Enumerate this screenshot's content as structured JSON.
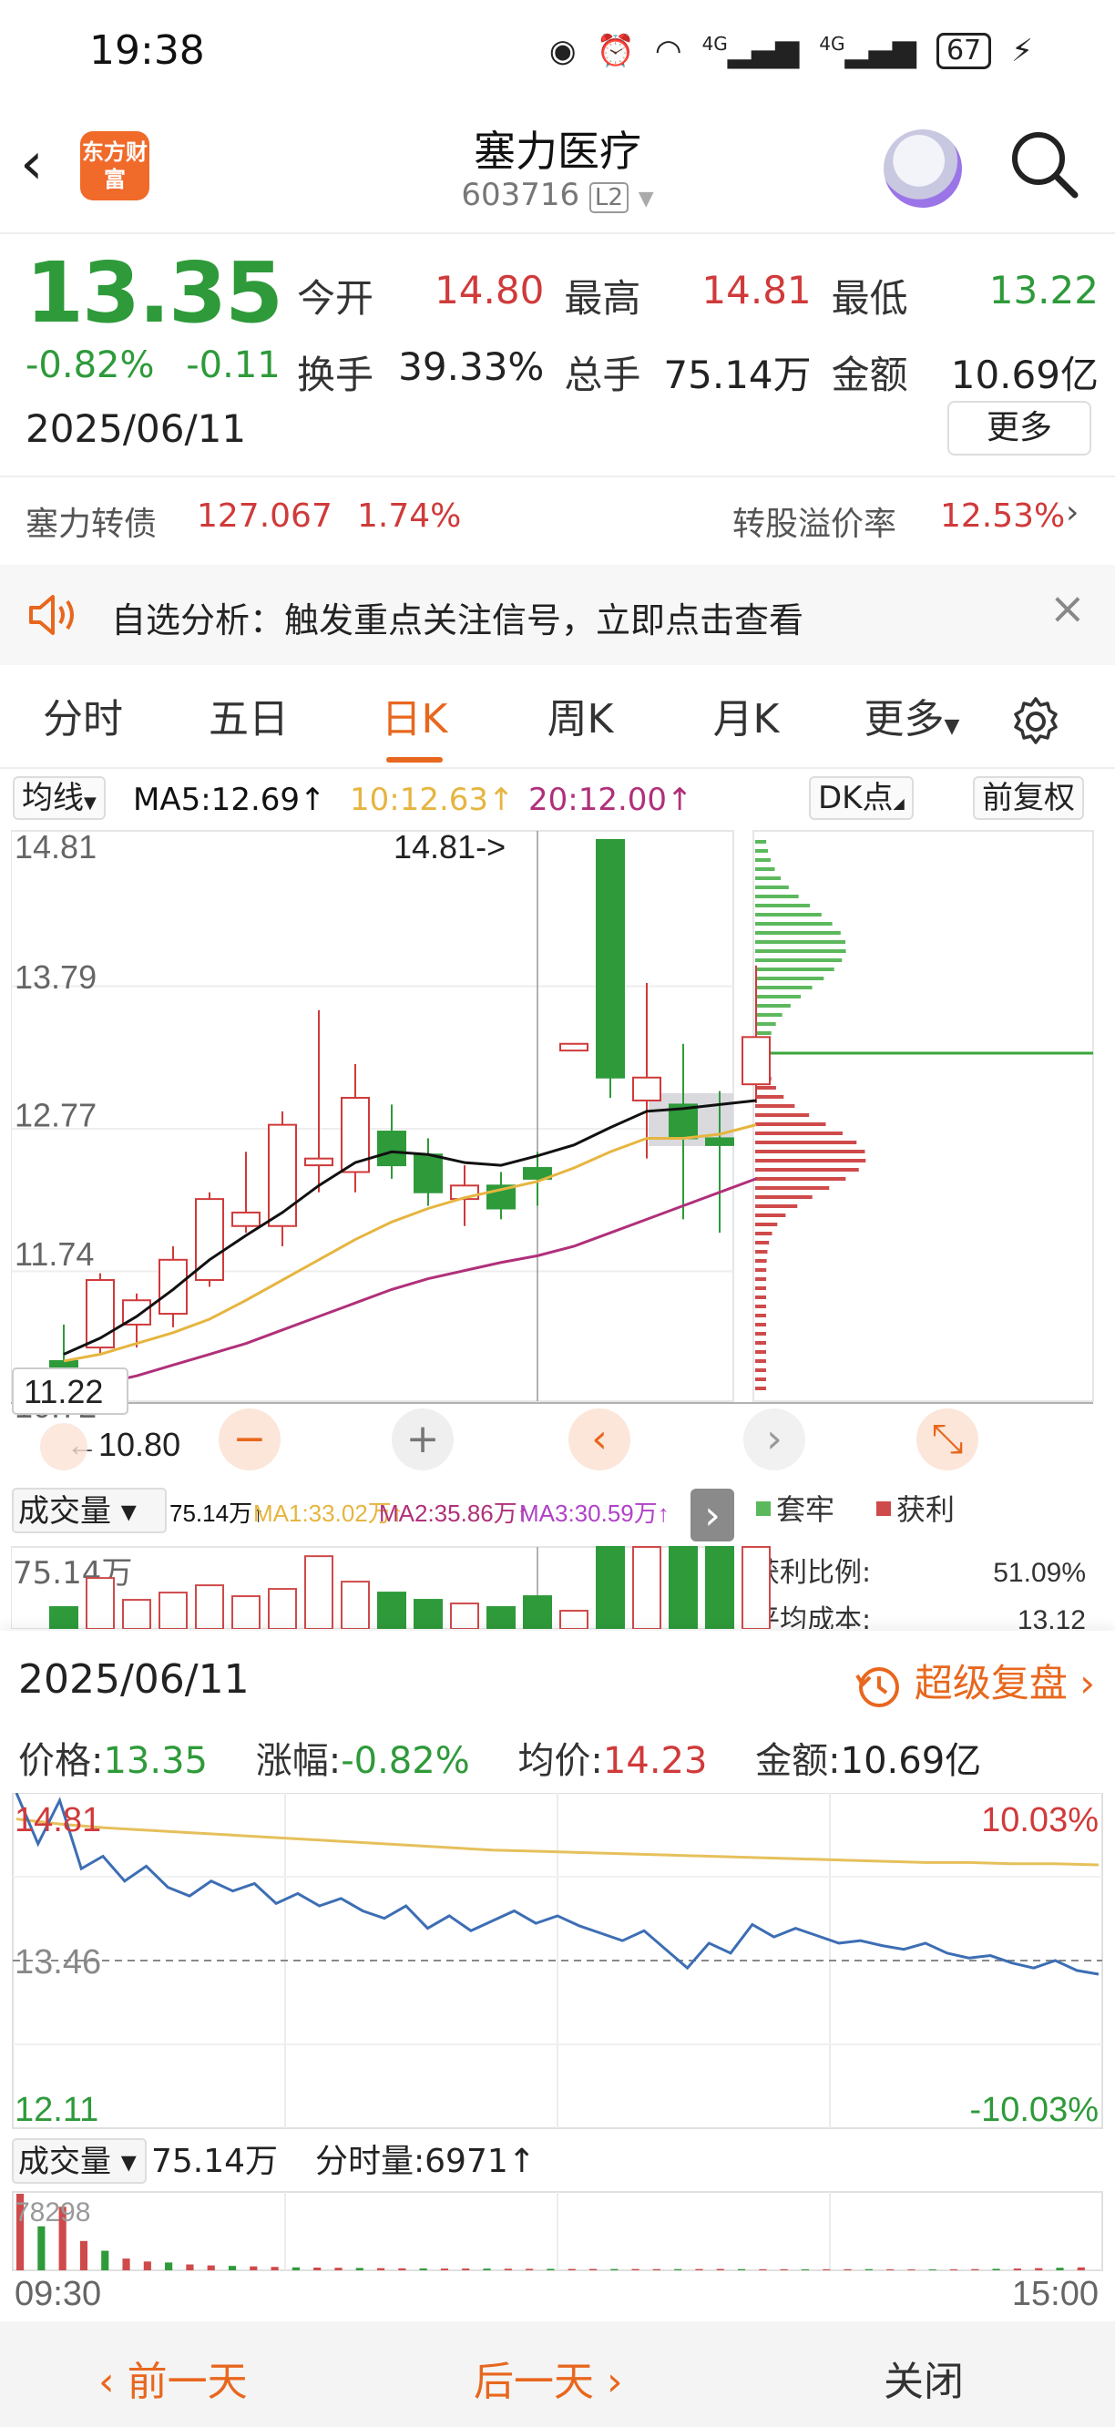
{
  "status_bar": {
    "time": "19:38",
    "network1": "4G",
    "network2": "4G",
    "battery": "67",
    "icons": [
      "eye-icon",
      "alarm-icon",
      "wifi-icon",
      "signal-icon",
      "signal-icon",
      "battery-icon",
      "charging-icon"
    ]
  },
  "header": {
    "logo_text": "东方财富",
    "stock_name": "塞力医疗",
    "stock_code": "603716",
    "level_badge": "L2"
  },
  "quote": {
    "price": "13.35",
    "change_pct": "-0.82%",
    "change_abs": "-0.11",
    "date": "2025/06/11",
    "stats": [
      {
        "label": "今开",
        "value": "14.80",
        "color": "red"
      },
      {
        "label": "最高",
        "value": "14.81",
        "color": "red"
      },
      {
        "label": "最低",
        "value": "13.22",
        "color": "green"
      },
      {
        "label": "换手",
        "value": "39.33%",
        "color": "black"
      },
      {
        "label": "总手",
        "value": "75.14万",
        "color": "black"
      },
      {
        "label": "金额",
        "value": "10.69亿",
        "color": "black"
      }
    ],
    "more_label": "更多"
  },
  "bond": {
    "label": "塞力转债",
    "price": "127.067",
    "pct": "1.74%",
    "premium_label": "转股溢价率",
    "premium_value": "12.53%"
  },
  "notice": {
    "text": "自选分析：触发重点关注信号，立即点击查看"
  },
  "tabs": [
    "分时",
    "五日",
    "日K",
    "周K",
    "月K",
    "更多"
  ],
  "ma_row": {
    "selector": "均线",
    "ma5": "MA5:12.69↑",
    "ma10": "10:12.63↑",
    "ma20": "20:12.00↑",
    "dk": "DK点",
    "adjust": "前复权"
  },
  "kline": {
    "y_labels": [
      "14.81",
      "13.79",
      "12.77",
      "11.74",
      "10.72"
    ],
    "high_marker": "14.81->",
    "low_marker": "←10.80",
    "cursor_price": "11.22",
    "volume_label": "成交量",
    "volume_ma": "75.14万↑",
    "vol_ma1": "MA1:33.02万↑",
    "vol_ma2": "MA2:35.86万↑",
    "vol_ma3": "MA3:30.59万↑",
    "volume_axis": "75.14万",
    "chip_legend_trapped": "套牢",
    "chip_legend_profit": "获利",
    "profit_ratio_label": "获利比例:",
    "profit_ratio_value": "51.09%",
    "avg_cost_label": "平均成本:",
    "avg_cost_value": "13.12"
  },
  "intraday": {
    "date": "2025/06/11",
    "replay_label": "超级复盘",
    "price_label": "价格:",
    "price": "13.35",
    "change_label": "涨幅:",
    "change": "-0.82%",
    "avg_label": "均价:",
    "avg": "14.23",
    "amount_label": "金额:",
    "amount": "10.69亿",
    "y_top": "14.81",
    "y_mid": "13.46",
    "y_bottom": "12.11",
    "pct_top": "10.03%",
    "pct_bottom": "-10.03%",
    "vol_label": "成交量",
    "vol_total": "75.14万",
    "tick_vol": "分时量:6971↑",
    "vol_axis": "78298",
    "time_start": "09:30",
    "time_end": "15:00"
  },
  "bottom_bar": {
    "prev": "前一天",
    "next": "后一天",
    "close": "关闭"
  },
  "colors": {
    "up": "#d03a3a",
    "down": "#2e9a3a",
    "accent": "#e8671e",
    "ma5": "#111111",
    "ma10": "#e6b540",
    "ma20": "#b0307a",
    "intraday_line": "#3d6eb4",
    "avg_line": "#e6c05c"
  },
  "chart_data": [
    {
      "type": "candlestick",
      "title": "日K",
      "ylim": [
        10.72,
        14.81
      ],
      "candles": [
        {
          "o": 10.95,
          "h": 11.22,
          "l": 10.8,
          "c": 10.8
        },
        {
          "o": 11.05,
          "h": 11.6,
          "l": 11.0,
          "c": 11.55
        },
        {
          "o": 11.22,
          "h": 11.45,
          "l": 11.05,
          "c": 11.4
        },
        {
          "o": 11.3,
          "h": 11.8,
          "l": 11.2,
          "c": 11.7
        },
        {
          "o": 11.55,
          "h": 12.2,
          "l": 11.5,
          "c": 12.15
        },
        {
          "o": 11.95,
          "h": 12.5,
          "l": 11.9,
          "c": 12.05
        },
        {
          "o": 11.95,
          "h": 12.8,
          "l": 11.8,
          "c": 12.7
        },
        {
          "o": 12.4,
          "h": 13.55,
          "l": 12.2,
          "c": 12.45
        },
        {
          "o": 12.35,
          "h": 13.15,
          "l": 12.2,
          "c": 12.9
        },
        {
          "o": 12.65,
          "h": 12.85,
          "l": 12.3,
          "c": 12.4
        },
        {
          "o": 12.48,
          "h": 12.6,
          "l": 12.1,
          "c": 12.2
        },
        {
          "o": 12.15,
          "h": 12.4,
          "l": 11.95,
          "c": 12.25
        },
        {
          "o": 12.25,
          "h": 12.35,
          "l": 12.0,
          "c": 12.08
        },
        {
          "o": 12.38,
          "h": 12.5,
          "l": 12.1,
          "c": 12.3
        },
        {
          "o": 13.25,
          "h": 13.28,
          "l": 13.25,
          "c": 13.3
        },
        {
          "o": 14.81,
          "h": 14.81,
          "l": 12.9,
          "c": 13.05
        },
        {
          "o": 12.88,
          "h": 13.75,
          "l": 12.45,
          "c": 13.05
        },
        {
          "o": 12.85,
          "h": 13.3,
          "l": 12.0,
          "c": 12.6
        },
        {
          "o": 12.6,
          "h": 12.95,
          "l": 11.9,
          "c": 12.55
        },
        {
          "o": 13.0,
          "h": 13.88,
          "l": 12.86,
          "c": 13.35
        }
      ],
      "ma5": [
        11.0,
        11.12,
        11.28,
        11.48,
        11.7,
        11.88,
        12.05,
        12.25,
        12.42,
        12.5,
        12.48,
        12.42,
        12.4,
        12.47,
        12.55,
        12.68,
        12.8,
        12.82,
        12.85,
        12.88
      ],
      "ma10": [
        10.95,
        11.0,
        11.08,
        11.16,
        11.26,
        11.4,
        11.55,
        11.7,
        11.85,
        11.98,
        12.08,
        12.16,
        12.22,
        12.28,
        12.38,
        12.5,
        12.6,
        12.6,
        12.63,
        12.7
      ],
      "ma20": [
        10.72,
        10.78,
        10.84,
        10.92,
        11.0,
        11.08,
        11.18,
        11.28,
        11.38,
        11.48,
        11.56,
        11.62,
        11.68,
        11.73,
        11.8,
        11.9,
        12.0,
        12.1,
        12.2,
        12.3
      ],
      "volume_ylim": [
        0,
        75.14
      ],
      "volume": [
        6,
        14,
        8,
        10,
        12,
        9,
        11,
        20,
        13,
        10,
        8,
        7,
        6,
        9,
        5,
        75.14,
        40,
        35,
        30,
        25
      ]
    },
    {
      "type": "line",
      "title": "分时",
      "ylim": [
        12.11,
        14.81
      ],
      "x": [
        "09:30",
        "15:00"
      ],
      "series": [
        {
          "values": [
            14.81,
            14.4,
            14.75,
            14.2,
            14.3,
            14.1,
            14.22,
            14.05,
            13.98,
            14.1,
            14.02,
            14.08,
            13.92,
            14.0,
            13.9,
            13.96,
            13.86,
            13.8,
            13.9,
            13.72,
            13.82,
            13.7,
            13.78,
            13.86,
            13.76,
            13.82,
            13.74,
            13.68,
            13.62,
            13.7,
            13.55,
            13.4,
            13.6,
            13.52,
            13.75,
            13.65,
            13.72,
            13.66,
            13.6,
            13.62,
            13.58,
            13.55,
            13.6,
            13.52,
            13.48,
            13.5,
            13.44,
            13.4,
            13.46,
            13.38,
            13.35
          ]
        },
        {
          "values": [
            14.6,
            14.56,
            14.53,
            14.51,
            14.49,
            14.47,
            14.45,
            14.43,
            14.41,
            14.39,
            14.37,
            14.35,
            14.34,
            14.33,
            14.32,
            14.31,
            14.3,
            14.29,
            14.28,
            14.27,
            14.26,
            14.25,
            14.25,
            14.24,
            14.24,
            14.23
          ]
        }
      ],
      "volume_ylim": [
        0,
        78298
      ],
      "volume": [
        78298,
        45000,
        65000,
        30000,
        20000,
        12000,
        9000,
        8000,
        6000,
        5000,
        4500,
        4000,
        3500,
        3000,
        2800,
        2600,
        2400,
        2200,
        2000,
        1900,
        1800,
        1800,
        1700,
        1600,
        1500,
        1500,
        1400,
        1400,
        1300,
        1300,
        1200,
        1200,
        1300,
        1400,
        1200,
        1100,
        1100,
        1000,
        1000,
        1100,
        1200,
        1000,
        900,
        900,
        1000,
        1200,
        1500,
        1800,
        2200,
        2600,
        3000
      ]
    }
  ]
}
